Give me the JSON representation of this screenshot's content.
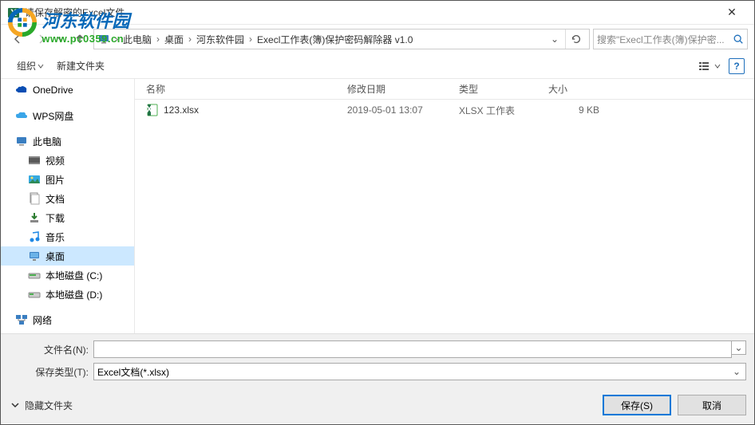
{
  "watermark": {
    "brand": "河东软件园",
    "url": "www.pc0359.cn"
  },
  "titlebar": {
    "title": "请保存解密的Excel文件"
  },
  "breadcrumb": {
    "segments": [
      "此电脑",
      "桌面",
      "河东软件园",
      "Execl工作表(簿)保护密码解除器 v1.0"
    ]
  },
  "search": {
    "placeholder": "搜索\"Execl工作表(簿)保护密..."
  },
  "toolbar": {
    "organize": "组织",
    "new_folder": "新建文件夹",
    "help_glyph": "?"
  },
  "sidebar": {
    "items": [
      {
        "label": "OneDrive",
        "icon": "onedrive"
      },
      {
        "label": "WPS网盘",
        "icon": "wps"
      },
      {
        "label": "此电脑",
        "icon": "pc"
      },
      {
        "label": "视频",
        "icon": "video"
      },
      {
        "label": "图片",
        "icon": "pictures"
      },
      {
        "label": "文档",
        "icon": "docs"
      },
      {
        "label": "下载",
        "icon": "download"
      },
      {
        "label": "音乐",
        "icon": "music"
      },
      {
        "label": "桌面",
        "icon": "desktop",
        "selected": true
      },
      {
        "label": "本地磁盘 (C:)",
        "icon": "drive"
      },
      {
        "label": "本地磁盘 (D:)",
        "icon": "drive"
      },
      {
        "label": "网络",
        "icon": "network"
      }
    ]
  },
  "filelist": {
    "headers": {
      "name": "名称",
      "date": "修改日期",
      "type": "类型",
      "size": "大小"
    },
    "rows": [
      {
        "name": "123.xlsx",
        "date": "2019-05-01 13:07",
        "type": "XLSX 工作表",
        "size": "9 KB"
      }
    ]
  },
  "form": {
    "filename_label": "文件名(N):",
    "filename_value": "",
    "filetype_label": "保存类型(T):",
    "filetype_value": "Excel文档(*.xlsx)"
  },
  "buttons": {
    "hide_folders": "隐藏文件夹",
    "save": "保存(S)",
    "cancel": "取消"
  }
}
